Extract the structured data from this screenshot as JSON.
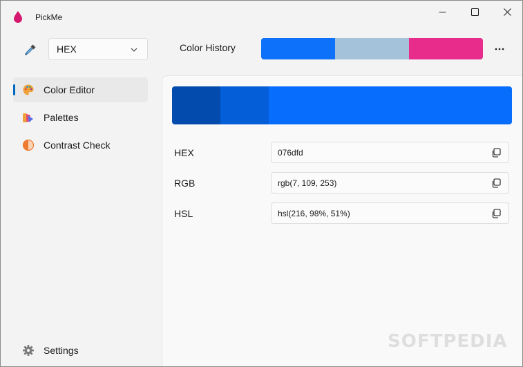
{
  "app": {
    "title": "PickMe",
    "accent": "#0067c0"
  },
  "window_controls": {
    "minimize_icon": "minimize-icon",
    "maximize_icon": "maximize-icon",
    "close_icon": "close-icon"
  },
  "toolbar": {
    "picker_icon": "eyedropper-icon",
    "format_select": {
      "value": "HEX"
    },
    "history_label": "Color History",
    "history_colors": [
      "#0d71fa",
      "#a4c2d9",
      "#e82c8c"
    ],
    "more_icon": "more-icon"
  },
  "sidebar": {
    "items": [
      {
        "label": "Color Editor",
        "icon": "palette-icon",
        "selected": true
      },
      {
        "label": "Palettes",
        "icon": "palettes-icon",
        "selected": false
      },
      {
        "label": "Contrast Check",
        "icon": "contrast-icon",
        "selected": false
      }
    ],
    "footer": {
      "label": "Settings",
      "icon": "gear-icon"
    }
  },
  "editor": {
    "swatch": {
      "shades": [
        "#034bad",
        "#045ed8"
      ],
      "current": "#076dfd"
    },
    "rows": [
      {
        "label": "HEX",
        "value": "076dfd"
      },
      {
        "label": "RGB",
        "value": "rgb(7, 109, 253)"
      },
      {
        "label": "HSL",
        "value": "hsl(216, 98%, 51%)"
      }
    ]
  },
  "watermark": "SOFTPEDIA"
}
